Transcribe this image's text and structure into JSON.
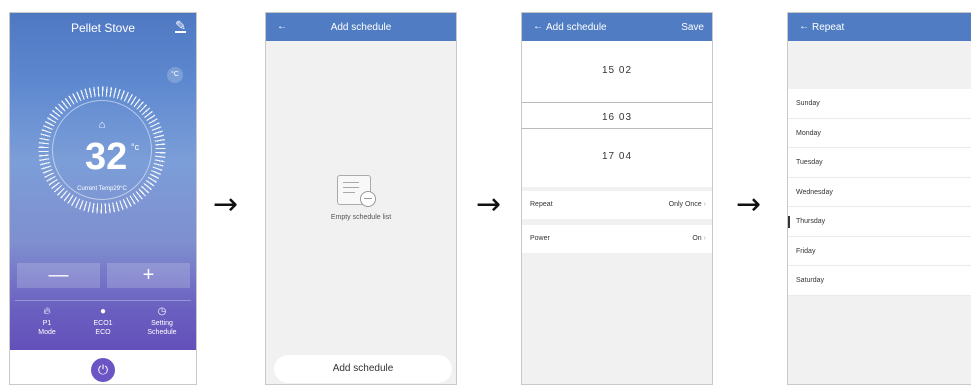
{
  "screen1": {
    "title": "Pellet Stove",
    "edit_icon": "pencil-icon",
    "unit_badge": "°C",
    "temperature": "32",
    "temp_unit": "°c",
    "current_temp": "Current Temp29°C",
    "minus": "—",
    "plus": "+",
    "modes": [
      {
        "icon": "flame-icon",
        "line1": "P1",
        "line2": "Mode"
      },
      {
        "icon": "leaf-icon",
        "line1": "ECO1",
        "line2": "ECO"
      },
      {
        "icon": "clock-icon",
        "line1": "Setting",
        "line2": "Schedule"
      }
    ],
    "power_icon": "power-icon"
  },
  "screen2": {
    "back": "←",
    "title": "Add schedule",
    "empty_text": "Empty schedule list",
    "add_button": "Add schedule"
  },
  "screen3": {
    "back": "←",
    "title": "Add schedule",
    "save": "Save",
    "picker_rows": [
      "15  02",
      "16  03",
      "17  04"
    ],
    "repeat_label": "Repeat",
    "repeat_value": "Only Once",
    "power_label": "Power",
    "power_value": "On"
  },
  "screen4": {
    "back": "←",
    "title": "Repeat",
    "days": [
      "Sunday",
      "Monday",
      "Tuesday",
      "Wednesday",
      "Thursday",
      "Friday",
      "Saturday"
    ]
  },
  "arrows": [
    "→",
    "→",
    "→"
  ],
  "colors": {
    "header": "#4f7cc2",
    "power_button": "#6b55c4"
  }
}
